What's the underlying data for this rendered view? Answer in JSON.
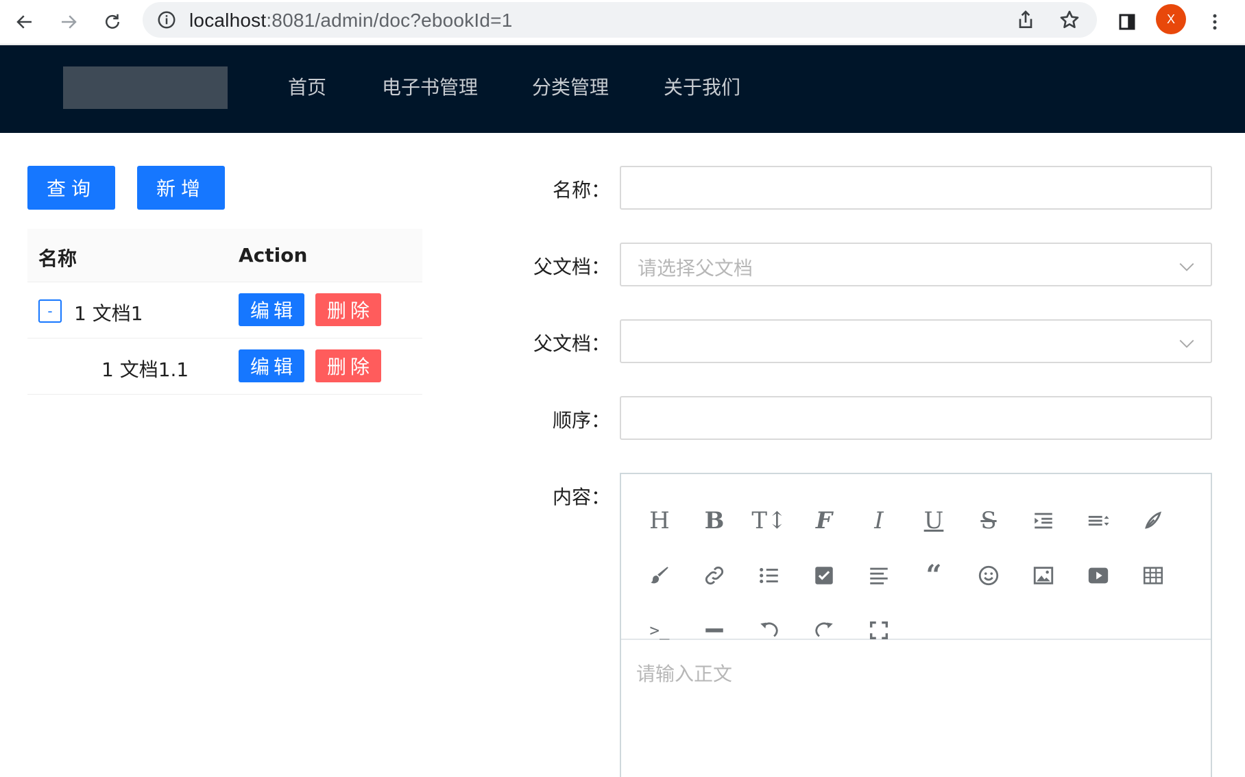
{
  "browser": {
    "url_host": "localhost",
    "url_path": ":8081/admin/doc?ebookId=1",
    "profile_initial": "X"
  },
  "header": {
    "nav": [
      "首页",
      "电子书管理",
      "分类管理",
      "关于我们"
    ]
  },
  "actions": {
    "query_label": "查询",
    "add_label": "新增"
  },
  "table": {
    "columns": [
      "名称",
      "Action"
    ],
    "rows": [
      {
        "expand_symbol": "-",
        "name": "1 文档1",
        "edit_label": "编辑",
        "delete_label": "删除"
      },
      {
        "name": "1 文档1.1",
        "edit_label": "编辑",
        "delete_label": "删除"
      }
    ]
  },
  "form": {
    "name_label": "名称：",
    "parent_label": "父文档：",
    "parent_placeholder": "请选择父文档",
    "parent2_label": "父文档：",
    "order_label": "顺序：",
    "content_label": "内容：",
    "content_placeholder": "请输入正文"
  },
  "editor_toolbar": [
    "heading-icon",
    "bold-icon",
    "font-size-icon",
    "font-family-icon",
    "italic-icon",
    "underline-icon",
    "strikethrough-icon",
    "indent-icon",
    "line-height-icon",
    "font-color-icon",
    "background-color-icon",
    "link-icon",
    "list-icon",
    "todo-icon",
    "justify-icon",
    "quote-icon",
    "emoticon-icon",
    "image-icon",
    "video-icon",
    "table-icon",
    "code-icon",
    "divider-icon",
    "undo-icon",
    "redo-icon",
    "fullscreen-icon"
  ]
}
